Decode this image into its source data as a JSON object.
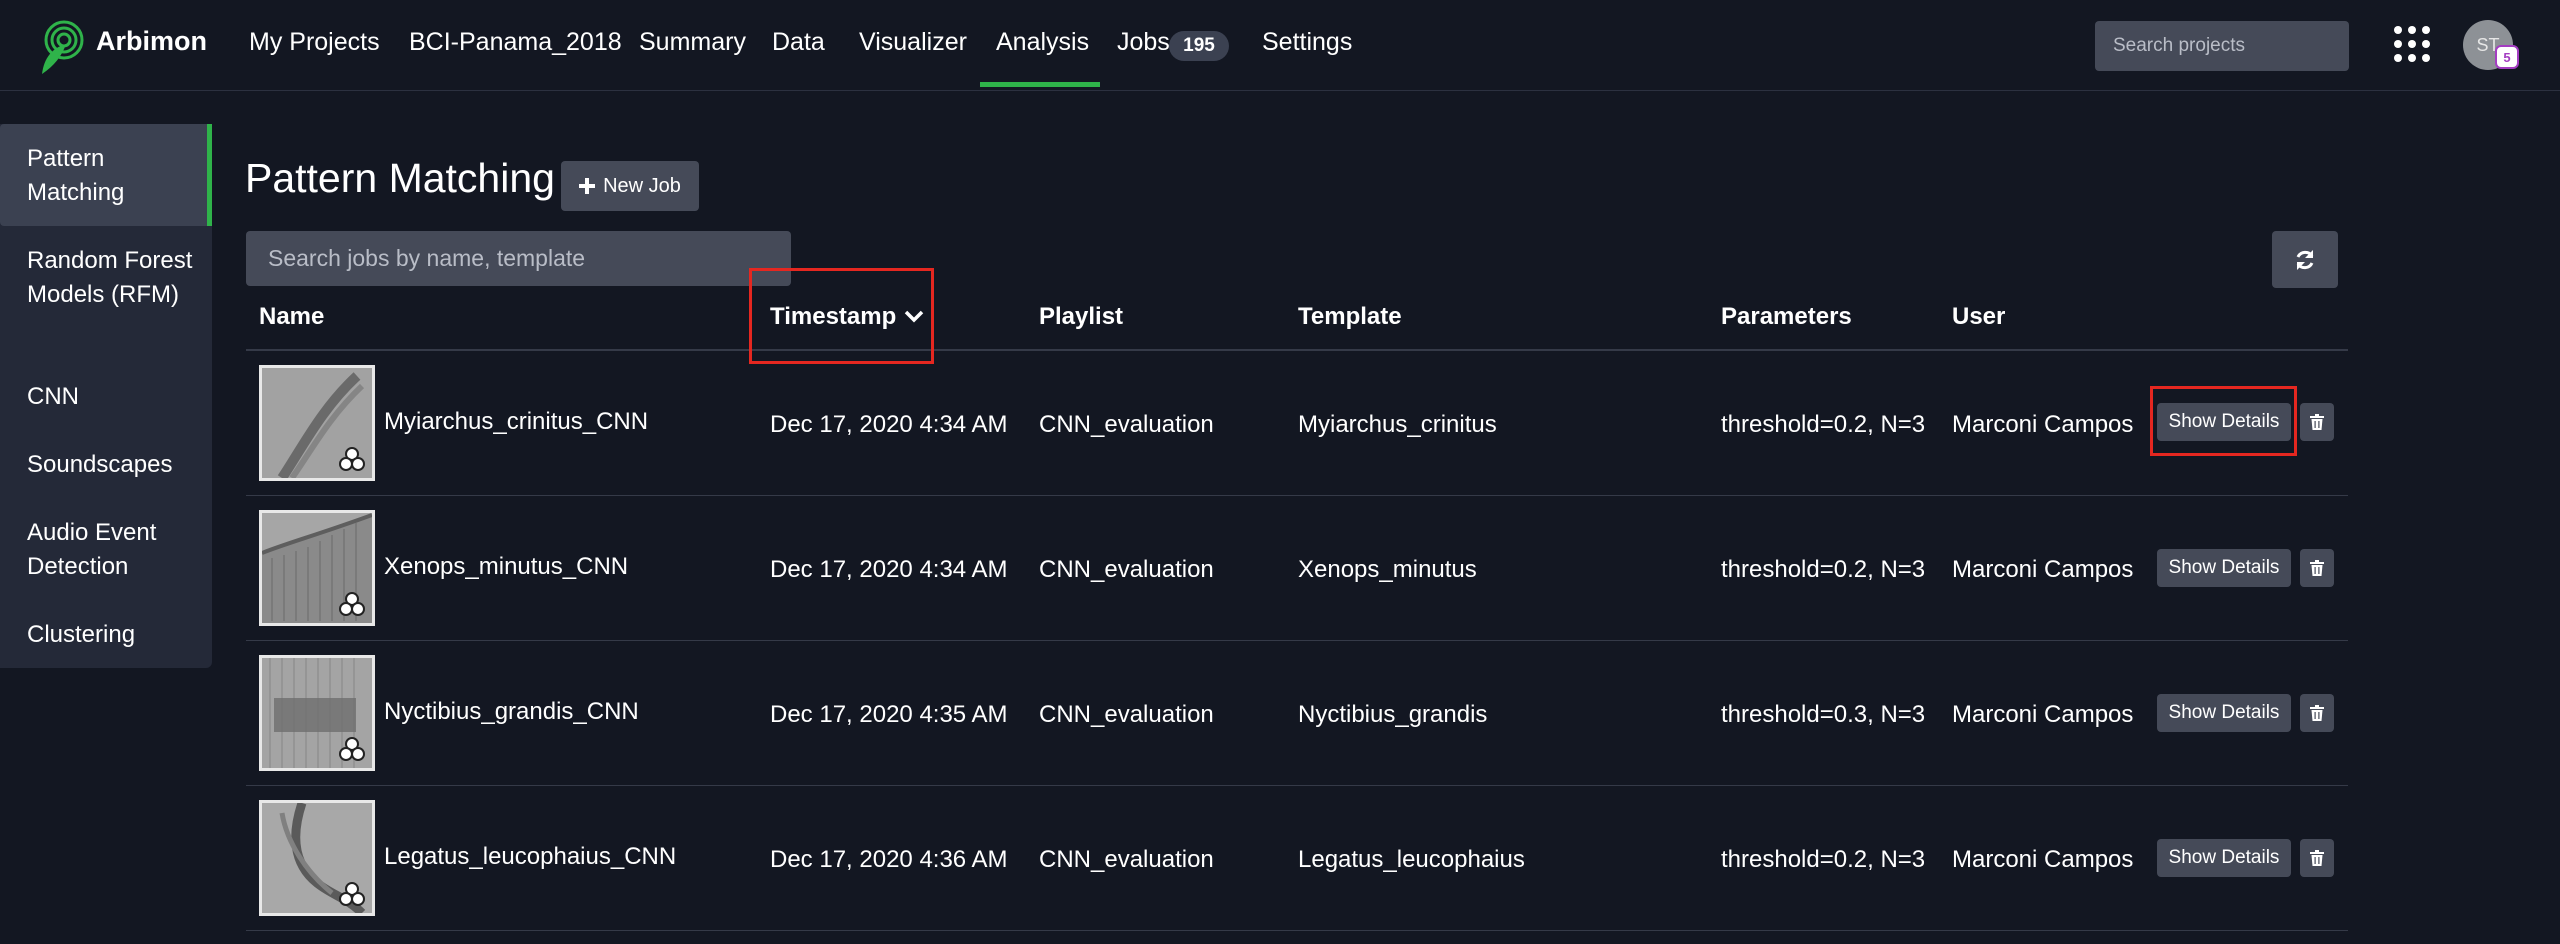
{
  "nav": {
    "brand": "Arbimon",
    "items": [
      "My Projects",
      "BCI-Panama_2018",
      "Summary",
      "Data",
      "Visualizer",
      "Analysis",
      "Jobs",
      "Settings"
    ],
    "active": "Analysis",
    "jobs_count": "195",
    "search_placeholder": "Search projects",
    "avatar_initials": "ST",
    "avatar_badge": "5"
  },
  "sidebar": {
    "items": [
      {
        "label": "Pattern Matching",
        "active": true
      },
      {
        "label": "Random Forest Models (RFM)",
        "active": false
      },
      {
        "label": "CNN",
        "active": false
      },
      {
        "label": "Soundscapes",
        "active": false
      },
      {
        "label": "Audio Event Detection",
        "active": false
      },
      {
        "label": "Clustering",
        "active": false
      }
    ]
  },
  "main": {
    "title": "Pattern Matching",
    "new_job_label": "New Job",
    "search_placeholder": "Search jobs by name, template",
    "columns": [
      "Name",
      "Timestamp",
      "Playlist",
      "Template",
      "Parameters",
      "User"
    ],
    "show_details_label": "Show Details",
    "rows": [
      {
        "name": "Myiarchus_crinitus_CNN",
        "timestamp": "Dec 17, 2020 4:34 AM",
        "playlist": "CNN_evaluation",
        "template": "Myiarchus_crinitus",
        "parameters": "threshold=0.2, N=3",
        "user": "Marconi Campos"
      },
      {
        "name": "Xenops_minutus_CNN",
        "timestamp": "Dec 17, 2020 4:34 AM",
        "playlist": "CNN_evaluation",
        "template": "Xenops_minutus",
        "parameters": "threshold=0.2, N=3",
        "user": "Marconi Campos"
      },
      {
        "name": "Nyctibius_grandis_CNN",
        "timestamp": "Dec 17, 2020 4:35 AM",
        "playlist": "CNN_evaluation",
        "template": "Nyctibius_grandis",
        "parameters": "threshold=0.3, N=3",
        "user": "Marconi Campos"
      },
      {
        "name": "Legatus_leucophaius_CNN",
        "timestamp": "Dec 17, 2020 4:36 AM",
        "playlist": "CNN_evaluation",
        "template": "Legatus_leucophaius",
        "parameters": "threshold=0.2, N=3",
        "user": "Marconi Campos"
      }
    ]
  },
  "colors": {
    "accent": "#2fb34a",
    "background": "#131722",
    "highlight": "#e52720"
  }
}
